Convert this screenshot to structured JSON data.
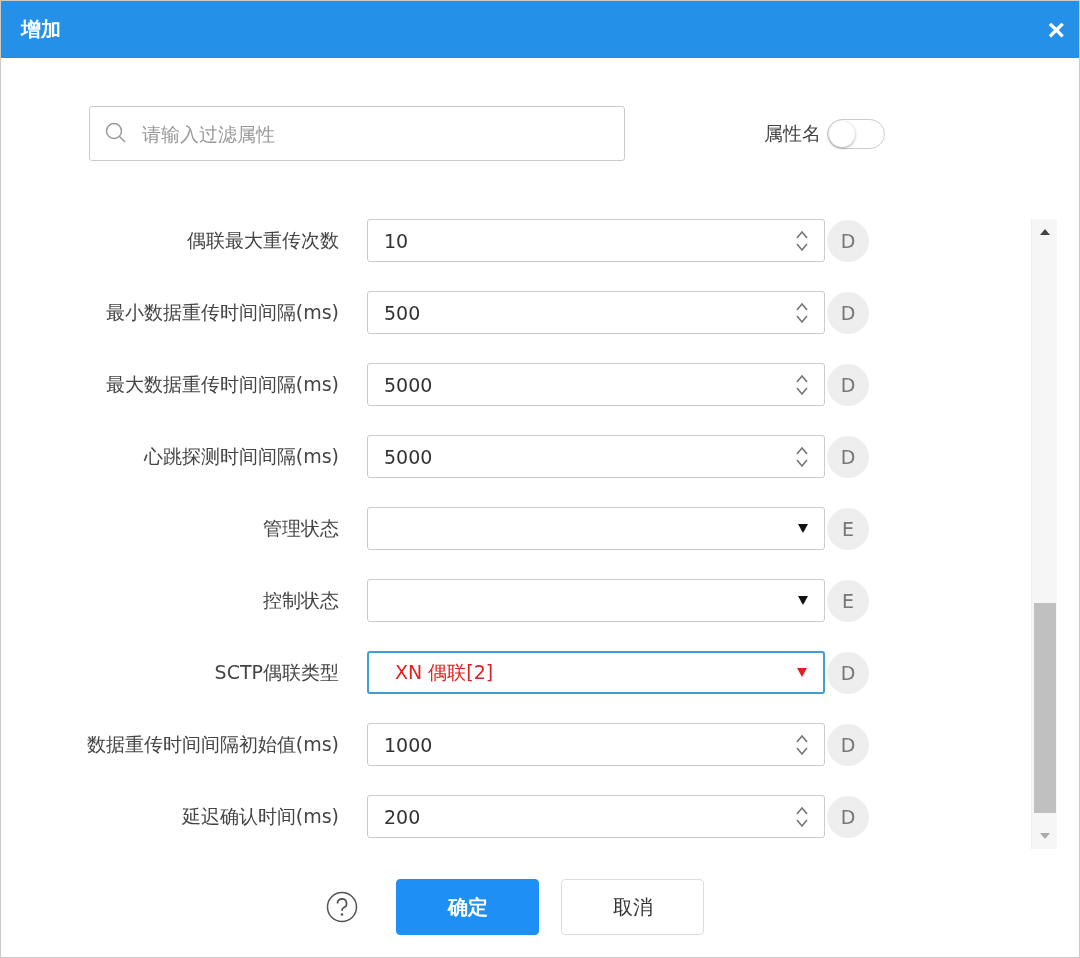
{
  "window": {
    "title": "增加",
    "close": "×"
  },
  "filter": {
    "placeholder": "请输入过滤属性",
    "toggle_label": "属性名",
    "toggle_on": false
  },
  "fields": [
    {
      "label": "偶联最大重传次数",
      "kind": "number",
      "value": "10",
      "badge": "D",
      "highlighted": false
    },
    {
      "label": "最小数据重传时间间隔(ms)",
      "kind": "number",
      "value": "500",
      "badge": "D",
      "highlighted": false
    },
    {
      "label": "最大数据重传时间间隔(ms)",
      "kind": "number",
      "value": "5000",
      "badge": "D",
      "highlighted": false
    },
    {
      "label": "心跳探测时间间隔(ms)",
      "kind": "number",
      "value": "5000",
      "badge": "D",
      "highlighted": false
    },
    {
      "label": "管理状态",
      "kind": "select",
      "badge": "E",
      "highlighted": false
    },
    {
      "label": "控制状态",
      "kind": "select",
      "badge": "E",
      "highlighted": false
    },
    {
      "label": "SCTP偶联类型",
      "kind": "select",
      "value": "XN 偶联[2]",
      "badge": "D",
      "highlighted": true
    },
    {
      "label": "数据重传时间间隔初始值(ms)",
      "kind": "number",
      "value": "1000",
      "badge": "D",
      "highlighted": false
    },
    {
      "label": "延迟确认时间(ms)",
      "kind": "number",
      "value": "200",
      "badge": "D",
      "highlighted": false
    }
  ],
  "buttons": [
    {
      "label": "确定",
      "primary": true
    },
    {
      "label": "取消",
      "primary": false
    }
  ]
}
